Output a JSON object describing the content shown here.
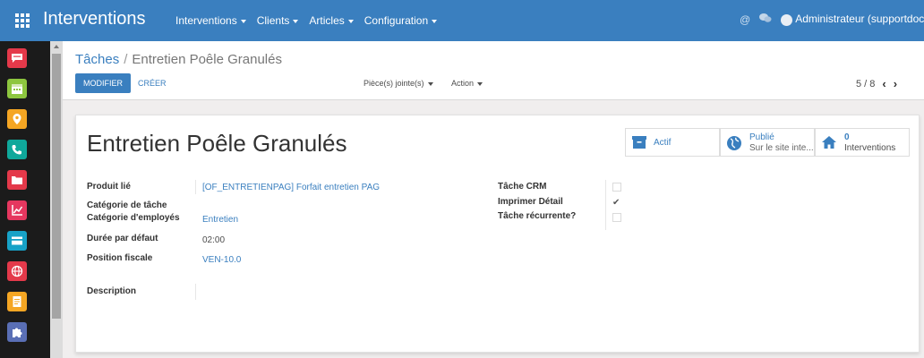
{
  "navbar": {
    "brand": "Interventions",
    "menus": [
      "Interventions",
      "Clients",
      "Articles",
      "Configuration"
    ],
    "user": "Administrateur (supportdoc)",
    "accent": "#3a7fbf"
  },
  "sidebar_apps": [
    {
      "icon": "chat-icon",
      "color": "#e4394a"
    },
    {
      "icon": "calendar-icon",
      "color": "#8dc63f"
    },
    {
      "icon": "location-icon",
      "color": "#f5a623"
    },
    {
      "icon": "phone-icon",
      "color": "#0fa89b"
    },
    {
      "icon": "folder-icon",
      "color": "#e4394a"
    },
    {
      "icon": "chart-icon",
      "color": "#e5375f"
    },
    {
      "icon": "card-icon",
      "color": "#17a2c7"
    },
    {
      "icon": "globe-icon",
      "color": "#e4394a"
    },
    {
      "icon": "document-icon",
      "color": "#f5a623"
    },
    {
      "icon": "puzzle-icon",
      "color": "#5a6fb5"
    }
  ],
  "control": {
    "breadcrumb_parent": "Tâches",
    "breadcrumb_separator": "/",
    "breadcrumb_current": "Entretien Poêle Granulés",
    "edit_label": "MODIFIER",
    "create_label": "CRÉER",
    "attachments_label": "Pièce(s) jointe(s)",
    "action_label": "Action",
    "pager_value": "5 / 8"
  },
  "form": {
    "title": "Entretien Poêle Granulés",
    "smart_buttons": {
      "active_label": "Actif",
      "published_label": "Publié",
      "published_sub": "Sur le site inte...",
      "interventions_count": "0",
      "interventions_label": "Interventions"
    },
    "left_fields": {
      "produit_lie_label": "Produit lié",
      "produit_lie_value": "[OF_ENTRETIENPAG] Forfait entretien PAG",
      "categorie_tache_label": "Catégorie de tâche",
      "categorie_employes_label": "Catégorie d'employés",
      "categorie_employes_value": "Entretien",
      "duree_label": "Durée par défaut",
      "duree_value": "02:00",
      "position_fiscale_label": "Position fiscale",
      "position_fiscale_value": "VEN-10.0",
      "description_label": "Description"
    },
    "right_fields": {
      "tache_crm_label": "Tâche CRM",
      "tache_crm_checked": false,
      "imprimer_detail_label": "Imprimer Détail",
      "imprimer_detail_checked": true,
      "tache_recurrente_label": "Tâche récurrente?",
      "tache_recurrente_checked": false
    }
  }
}
